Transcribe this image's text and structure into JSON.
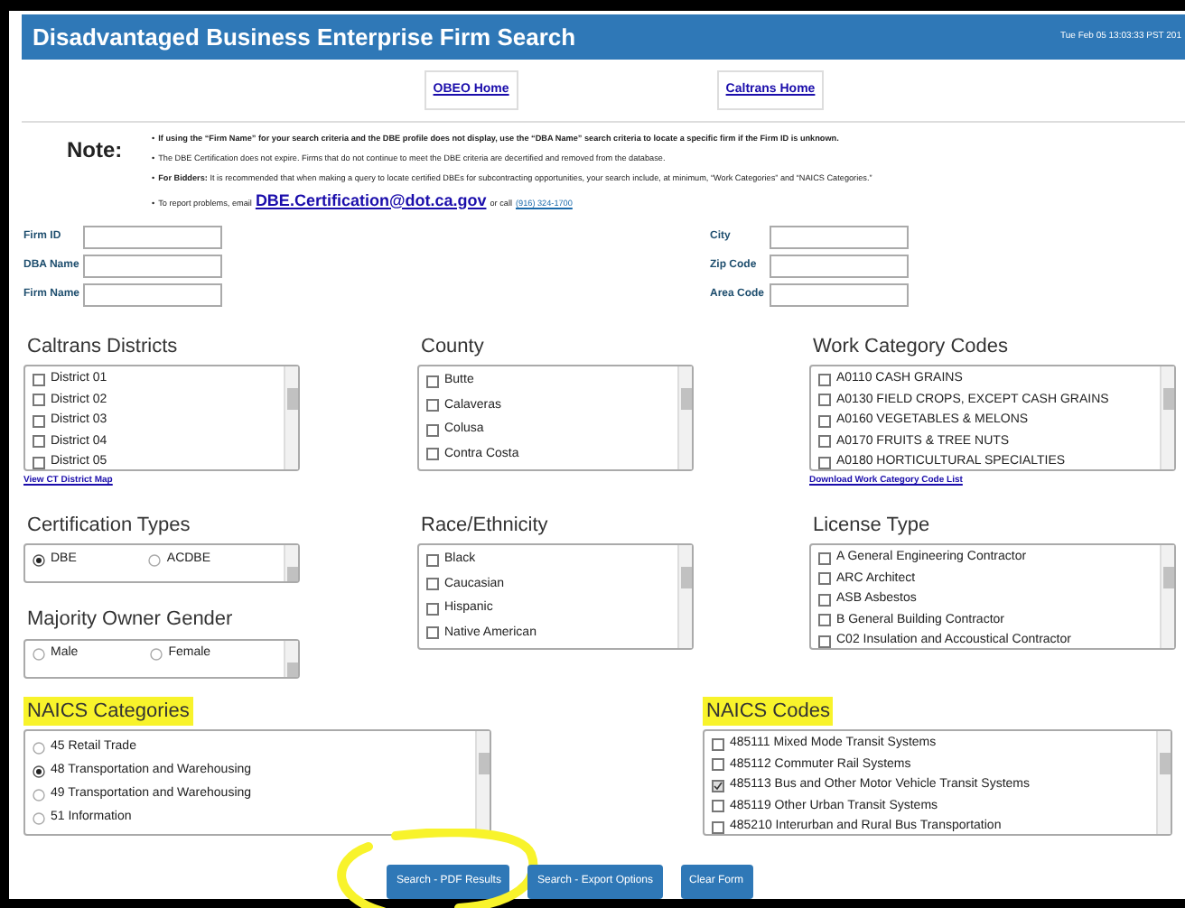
{
  "header": {
    "title": "Disadvantaged Business Enterprise Firm Search",
    "timestamp": "Tue Feb 05 13:03:33 PST 201"
  },
  "nav_links": [
    "OBEO Home",
    "Caltrans Home"
  ],
  "note": {
    "label": "Note:",
    "items": [
      {
        "bullet": "•",
        "text": "**If using the “Firm Name” for your search criteria and the DBE profile does not display, use the “DBA Name” search criteria to locate a specific firm if the Firm ID is unknown.**"
      },
      {
        "bullet": "•",
        "text": "The DBE Certification does not expire. Firms that do not continue to meet the DBE criteria are decertified and removed from the database."
      },
      {
        "bullet": "•",
        "text": "**For Bidders:** It is recommended that when making a query to locate certified DBEs for subcontracting opportunities, your search include, at minimum, “Work Categories” and “NAICS Categories.”"
      }
    ],
    "contact": {
      "bullet": "•",
      "before": "To report problems, email",
      "email": "DBE.Certification@dot.ca.gov",
      "middle": "or call",
      "phone": "(916) 324-1700"
    }
  },
  "fields_left": [
    {
      "label": "Firm ID"
    },
    {
      "label": "DBA Name"
    },
    {
      "label": "Firm Name"
    }
  ],
  "fields_right": [
    {
      "label": "City"
    },
    {
      "label": "Zip Code"
    },
    {
      "label": "Area Code"
    }
  ],
  "caltrans_districts": {
    "title": "Caltrans Districts",
    "link": "View CT District Map",
    "items": [
      {
        "label": "District 01",
        "checked": false
      },
      {
        "label": "District 02",
        "checked": false
      },
      {
        "label": "District 03",
        "checked": false
      },
      {
        "label": "District 04",
        "checked": false
      },
      {
        "label": "District 05",
        "checked": false
      }
    ]
  },
  "county": {
    "title": "County",
    "items": [
      {
        "label": "Butte",
        "checked": false
      },
      {
        "label": "Calaveras",
        "checked": false
      },
      {
        "label": "Colusa",
        "checked": false
      },
      {
        "label": "Contra Costa",
        "checked": false
      }
    ]
  },
  "work_category_codes": {
    "title": "Work Category Codes",
    "link": "Download Work Category Code List",
    "items": [
      {
        "label": "A0110 CASH GRAINS",
        "checked": false
      },
      {
        "label": "A0130 FIELD CROPS, EXCEPT CASH GRAINS",
        "checked": false
      },
      {
        "label": "A0160 VEGETABLES & MELONS",
        "checked": false
      },
      {
        "label": "A0170 FRUITS & TREE NUTS",
        "checked": false
      },
      {
        "label": "A0180 HORTICULTURAL SPECIALTIES",
        "checked": false
      }
    ]
  },
  "certification_types": {
    "title": "Certification Types",
    "options": [
      {
        "label": "DBE",
        "selected": true
      },
      {
        "label": "ACDBE",
        "selected": false
      }
    ]
  },
  "majority_owner_gender": {
    "title": "Majority Owner Gender",
    "options": [
      {
        "label": "Male",
        "selected": false
      },
      {
        "label": "Female",
        "selected": false
      }
    ]
  },
  "race_ethnicity": {
    "title": "Race/Ethnicity",
    "items": [
      {
        "label": "Black",
        "checked": false
      },
      {
        "label": "Caucasian",
        "checked": false
      },
      {
        "label": "Hispanic",
        "checked": false
      },
      {
        "label": "Native American",
        "checked": false
      }
    ]
  },
  "license_type": {
    "title": "License Type",
    "items": [
      {
        "label": "A General Engineering Contractor",
        "checked": false
      },
      {
        "label": "ARC Architect",
        "checked": false
      },
      {
        "label": "ASB Asbestos",
        "checked": false
      },
      {
        "label": "B General Building Contractor",
        "checked": false
      },
      {
        "label": "C02 Insulation and Accoustical Contractor",
        "checked": false
      }
    ]
  },
  "naics_categories": {
    "title": "NAICS Categories",
    "highlighted": true,
    "options": [
      {
        "label": "45 Retail Trade",
        "selected": false
      },
      {
        "label": "48 Transportation and Warehousing",
        "selected": true
      },
      {
        "label": "49 Transportation and Warehousing",
        "selected": false
      },
      {
        "label": "51 Information",
        "selected": false
      }
    ]
  },
  "naics_codes": {
    "title": "NAICS Codes",
    "highlighted": true,
    "items": [
      {
        "label": "485111 Mixed Mode Transit Systems",
        "checked": false
      },
      {
        "label": "485112 Commuter Rail Systems",
        "checked": false
      },
      {
        "label": "485113 Bus and Other Motor Vehicle Transit Systems",
        "checked": true
      },
      {
        "label": "485119 Other Urban Transit Systems",
        "checked": false
      },
      {
        "label": "485210 Interurban and Rural Bus Transportation",
        "checked": false
      }
    ]
  },
  "buttons": [
    {
      "label": "Search - PDF Results",
      "circled": true
    },
    {
      "label": "Search - Export Options",
      "circled": false
    },
    {
      "label": "Clear Form",
      "circled": false
    }
  ]
}
